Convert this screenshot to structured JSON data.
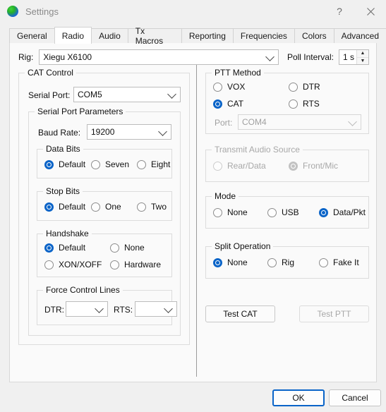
{
  "window": {
    "title": "Settings",
    "icon": "globe-icon",
    "help_label": "?",
    "close_label": "✕"
  },
  "tabs": [
    {
      "label": "General",
      "active": false
    },
    {
      "label": "Radio",
      "active": true
    },
    {
      "label": "Audio",
      "active": false
    },
    {
      "label": "Tx Macros",
      "active": false
    },
    {
      "label": "Reporting",
      "active": false
    },
    {
      "label": "Frequencies",
      "active": false
    },
    {
      "label": "Colors",
      "active": false
    },
    {
      "label": "Advanced",
      "active": false
    }
  ],
  "rig_row": {
    "rig_label": "Rig:",
    "rig_value": "Xiegu X6100",
    "poll_label": "Poll Interval:",
    "poll_value": "1 s",
    "spin_up": "▲",
    "spin_down": "▼"
  },
  "cat_control": {
    "title": "CAT Control",
    "serial_port_label": "Serial Port:",
    "serial_port_value": "COM5",
    "serial_port_parameters": {
      "title": "Serial Port Parameters",
      "baud_rate_label": "Baud Rate:",
      "baud_rate_value": "19200",
      "data_bits": {
        "title": "Data Bits",
        "options": [
          {
            "label": "Default",
            "selected": true
          },
          {
            "label": "Seven",
            "selected": false
          },
          {
            "label": "Eight",
            "selected": false
          }
        ]
      },
      "stop_bits": {
        "title": "Stop Bits",
        "options": [
          {
            "label": "Default",
            "selected": true
          },
          {
            "label": "One",
            "selected": false
          },
          {
            "label": "Two",
            "selected": false
          }
        ]
      },
      "handshake": {
        "title": "Handshake",
        "options": [
          {
            "label": "Default",
            "selected": true
          },
          {
            "label": "None",
            "selected": false
          },
          {
            "label": "XON/XOFF",
            "selected": false
          },
          {
            "label": "Hardware",
            "selected": false
          }
        ]
      },
      "force_control_lines": {
        "title": "Force Control Lines",
        "dtr_label": "DTR:",
        "dtr_value": "",
        "rts_label": "RTS:",
        "rts_value": ""
      }
    }
  },
  "ptt_method": {
    "title": "PTT Method",
    "options": [
      {
        "label": "VOX",
        "selected": false
      },
      {
        "label": "DTR",
        "selected": false
      },
      {
        "label": "CAT",
        "selected": true
      },
      {
        "label": "RTS",
        "selected": false
      }
    ],
    "port_label": "Port:",
    "port_value": "COM4",
    "port_disabled": true
  },
  "transmit_audio_source": {
    "title": "Transmit Audio Source",
    "disabled": true,
    "options": [
      {
        "label": "Rear/Data",
        "selected": false
      },
      {
        "label": "Front/Mic",
        "selected": true
      }
    ]
  },
  "mode": {
    "title": "Mode",
    "options": [
      {
        "label": "None",
        "selected": false
      },
      {
        "label": "USB",
        "selected": false
      },
      {
        "label": "Data/Pkt",
        "selected": true
      }
    ]
  },
  "split_operation": {
    "title": "Split Operation",
    "options": [
      {
        "label": "None",
        "selected": true
      },
      {
        "label": "Rig",
        "selected": false
      },
      {
        "label": "Fake It",
        "selected": false
      }
    ]
  },
  "test_buttons": {
    "test_cat": "Test CAT",
    "test_ptt": "Test PTT",
    "test_ptt_disabled": true
  },
  "footer": {
    "ok": "OK",
    "cancel": "Cancel"
  },
  "colors": {
    "accent": "#0a64c8",
    "window_bg": "#f0f0f0",
    "panel_bg": "#fafafa"
  }
}
